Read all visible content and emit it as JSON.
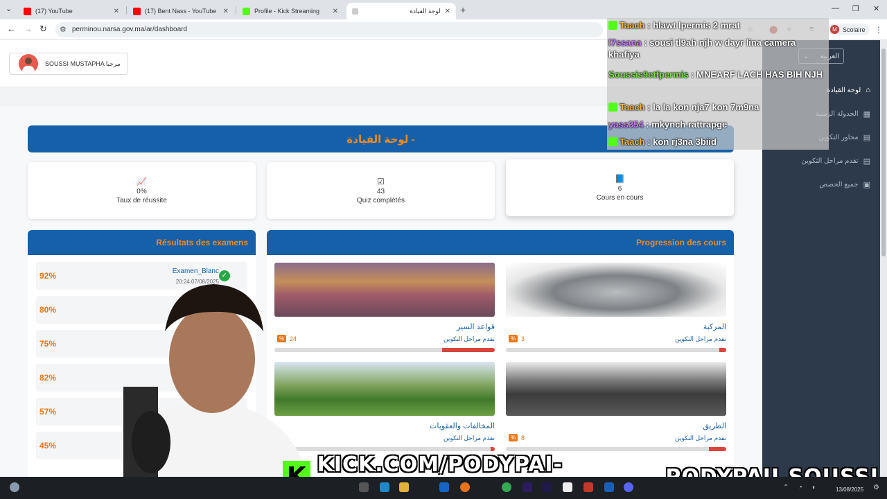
{
  "browser": {
    "tabs": [
      {
        "label": "(17) YouTube",
        "favicon_color": "#ff0000"
      },
      {
        "label": "(17) Bent Nass - YouTube",
        "favicon_color": "#ff0000"
      },
      {
        "label": "Profile - Kick Streaming",
        "favicon_color": "#53fc18"
      },
      {
        "label": "لوحة القيادة",
        "favicon_color": "#999999"
      }
    ],
    "url": "perminou.narsa.gov.ma/ar/dashboard",
    "profile_initial": "M",
    "profile_label": "Scolaire"
  },
  "page": {
    "welcome": "SOUSSI MUSTAPHA مرحبا",
    "dashboard_title": "لوحة القيادة -",
    "stats": [
      {
        "icon": "📈",
        "value": "0%",
        "label": "Taux de réussite"
      },
      {
        "icon": "☑",
        "value": "43",
        "label": "Quiz complétés"
      },
      {
        "icon": "📘",
        "value": "6",
        "label": "Cours en cours"
      }
    ],
    "results_title": "Résultats des examens",
    "results": [
      {
        "pct": "92%",
        "name": "Examen_Blanc",
        "date": "20:24 07/08/2025"
      },
      {
        "pct": "80%"
      },
      {
        "pct": "75%"
      },
      {
        "pct": "82%"
      },
      {
        "pct": "57%"
      },
      {
        "pct": "45%"
      }
    ],
    "courses_title": "Progression des cours",
    "courses": [
      {
        "name": "قواعد السير",
        "progress_label": "تقدم مراحل التكوين",
        "value": 24,
        "value_label": "24"
      },
      {
        "name": "المركبة",
        "progress_label": "تقدم مراحل التكوين",
        "value": 3,
        "value_label": "3"
      },
      {
        "name": "المخالفات والعقوبات",
        "progress_label": "تقدم مراحل التكوين",
        "value": 2,
        "value_label": ""
      },
      {
        "name": "الطريق",
        "progress_label": "تقدم مراحل التكوين",
        "value": 8,
        "value_label": "8"
      }
    ],
    "badge_symbol": "%"
  },
  "sidebar": {
    "language": "العربية",
    "items": [
      {
        "label": "لوحة القيادة",
        "icon": "home-icon",
        "glyph": "⌂"
      },
      {
        "label": "الجدولة الزمنية",
        "icon": "calendar-icon",
        "glyph": "▦"
      },
      {
        "label": "محاور التكوين",
        "icon": "book-icon",
        "glyph": "▤"
      },
      {
        "label": "تقدم مراحل التكوين",
        "icon": "book-icon",
        "glyph": "▤"
      },
      {
        "label": "جميع الحصص",
        "icon": "list-icon",
        "glyph": "▣"
      }
    ]
  },
  "chat": [
    {
      "user": "Taach",
      "msg": ": hlawt lpermis 2 mrat",
      "color": "orange"
    },
    {
      "user": "l7ssana",
      "msg": ": sousi tl9ah njh w dayr lina camera khafiya",
      "color": "pink"
    },
    {
      "user": "Soussis9etfpermis",
      "msg": ": MNEARF LACH HAS BIH NJH",
      "color": "green"
    },
    {
      "user": "Taach",
      "msg": ": la la kon nja7 kon 7m9na",
      "color": "orange"
    },
    {
      "user": "yass354",
      "msg": ": mkynch rattrapge",
      "color": "pink"
    },
    {
      "user": "Taach",
      "msg": ": kon rj3na 3biid",
      "color": "orange"
    }
  ],
  "overlay": {
    "kick_letter": "K",
    "kick_handle": "KICK.COM/PODYPAI-SOUSSI",
    "ig_handle": "PODYPAII.SOUSSI"
  },
  "taskbar": {
    "date": "13/08/2025"
  }
}
